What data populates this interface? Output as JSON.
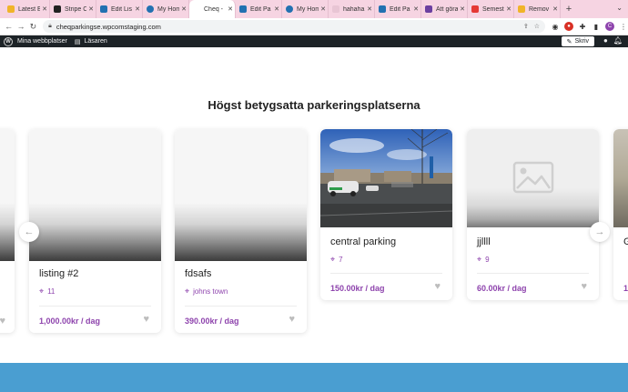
{
  "browser": {
    "tabs": [
      {
        "label": "Latest E",
        "color": "#f0b429"
      },
      {
        "label": "Stripe C",
        "color": "#222222"
      },
      {
        "label": "Edit Lis",
        "color": "#2271b1"
      },
      {
        "label": "My Hom",
        "color": "#2271b1"
      },
      {
        "label": "Cheq -",
        "color": "#ffffff",
        "active": true
      },
      {
        "label": "Edit Pa",
        "color": "#2271b1"
      },
      {
        "label": "My Hom",
        "color": "#2271b1"
      },
      {
        "label": "hahaha",
        "color": "#e8c5d4"
      },
      {
        "label": "Edit Pa",
        "color": "#2271b1"
      },
      {
        "label": "Att göra",
        "color": "#6b3fa0"
      },
      {
        "label": "Semest",
        "color": "#e53935"
      },
      {
        "label": "Remov",
        "color": "#f0b429"
      }
    ],
    "url": "cheqparkingse.wpcomstaging.com",
    "profile_initial": "C"
  },
  "wpbar": {
    "my_sites": "Mina webbplatser",
    "reader": "Läsaren",
    "write": "Skriv"
  },
  "section": {
    "title": "Högst betygsatta parkeringsplatserna"
  },
  "cards": [
    {
      "name": "listing #2",
      "location": "11",
      "price": "1,000.00kr / dag",
      "image": "blank"
    },
    {
      "name": "fdsafs",
      "location": "johns town",
      "price": "390.00kr / dag",
      "image": "blank"
    },
    {
      "name": "central parking",
      "location": "7",
      "price": "150.00kr / dag",
      "image": "photo"
    },
    {
      "name": "jjllll",
      "location": "9",
      "price": "60.00kr / dag",
      "image": "placeholder"
    },
    {
      "name": "G",
      "location": "",
      "price": "1",
      "image": "photo"
    }
  ],
  "icons": {
    "back": "arrow-left-icon",
    "forward": "arrow-right-icon",
    "reload": "reload-icon",
    "heart": "heart-icon",
    "pin": "map-pin-icon"
  }
}
